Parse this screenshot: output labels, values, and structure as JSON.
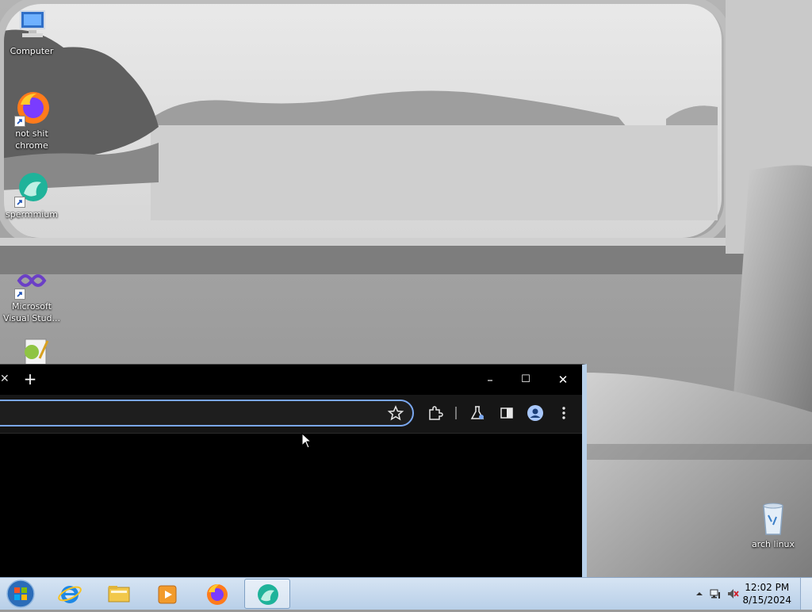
{
  "desktop": {
    "icons": [
      {
        "label": "Computer",
        "icon": "computer-icon"
      },
      {
        "label": "not shit\nchrome",
        "icon": "firefox-icon"
      },
      {
        "label": "spermmium",
        "icon": "spermmium-browser-icon"
      },
      {
        "label": "Microsoft\nVisual Stud...",
        "icon": "visual-studio-icon"
      },
      {
        "label": "",
        "icon": "notepad-plus-plus-icon"
      },
      {
        "label": "arch linux",
        "icon": "recycle-bin-icon"
      }
    ]
  },
  "browser": {
    "tab_close_glyph": "✕",
    "new_tab_glyph": "+",
    "window_controls": {
      "minimize": "–",
      "maximize": "☐",
      "close": "✕"
    },
    "omnibox": {
      "value": "",
      "placeholder": ""
    },
    "toolbar_icons": [
      "bookmark-star-icon",
      "extensions-icon",
      "labs-flask-icon",
      "side-panel-icon",
      "profile-icon",
      "menu-icon"
    ]
  },
  "taskbar": {
    "items": [
      "start-orb-icon",
      "internet-explorer-icon",
      "file-explorer-icon",
      "media-player-icon",
      "firefox-icon",
      "spermmium-browser-icon"
    ],
    "active_item": "spermmium-browser-icon",
    "clock": {
      "time": "12:02 PM",
      "date": "8/15/2024"
    }
  },
  "colors": {
    "taskbar": "#c6d8ee",
    "omnibox_border": "#7aa7ef",
    "window_border": "#b9d1ea"
  }
}
